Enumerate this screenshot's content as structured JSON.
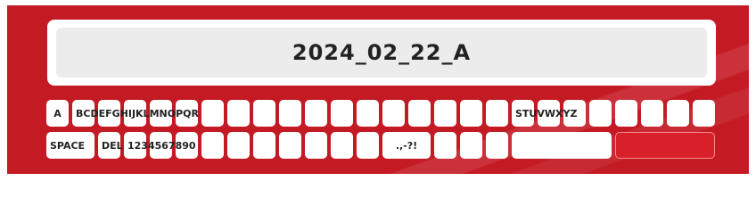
{
  "display": {
    "value": "2024_02_22_A"
  },
  "keyboard": {
    "row1": {
      "key_a": "A",
      "key_b_to_r": "BCDEFGHIJKLMNOPQR",
      "key_s_to_z": "STUVWXYZ"
    },
    "row2": {
      "space": "SPACE",
      "delete": "DEL",
      "digits": "1234567890",
      "punctuation": ".,-?!"
    }
  },
  "colors": {
    "panel": "#c41a24",
    "key": "#ffffff",
    "display": "#ececec",
    "confirm_key": "#d8202b"
  }
}
